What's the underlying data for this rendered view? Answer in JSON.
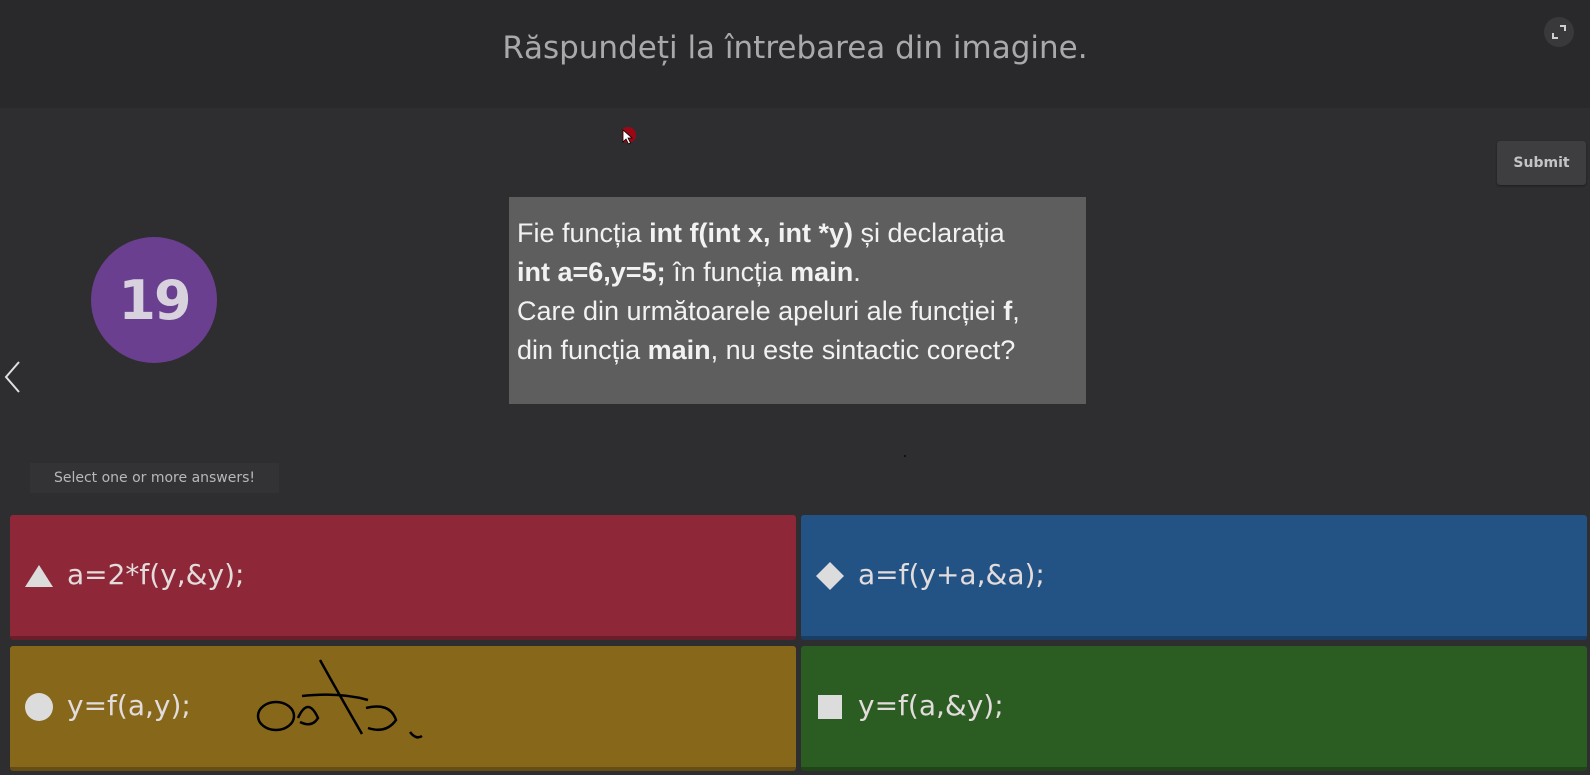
{
  "header": {
    "title": "Răspundeți la întrebarea din imagine.",
    "fullscreen_icon": "expand-icon"
  },
  "toolbar": {
    "submit_label": "Submit"
  },
  "question": {
    "number": "19",
    "image_text": {
      "line1_a": "Fie funcția ",
      "line1_b": "int f(int x, int *y)",
      "line1_c": " și declarația",
      "line2_a": "int a=6,y=5;",
      "line2_b": " în funcția ",
      "line2_c": "main",
      "line2_d": ".",
      "line3_a": "Care din următoarele apeluri ale funcției ",
      "line3_b": "f",
      "line3_c": ",",
      "line4_a": "din funcția ",
      "line4_b": "main",
      "line4_c": ", nu este sintactic corect?"
    }
  },
  "hint": "Select one or more answers!",
  "answers": [
    {
      "shape": "triangle-icon",
      "color": "#8e2838",
      "text": "a=2*f(y,&y);"
    },
    {
      "shape": "diamond-icon",
      "color": "#235385",
      "text": "a=f(y+a,&a);"
    },
    {
      "shape": "circle-icon",
      "color": "#87681a",
      "text": "y=f(a,y);",
      "annotation": "handwritten-scribble"
    },
    {
      "shape": "square-icon",
      "color": "#2b5d22",
      "text": "y=f(a,&y);"
    }
  ],
  "colors": {
    "background": "#2e2e30",
    "header": "#29292b",
    "badge": "#6a3f8f",
    "image_box": "#5e5e5e"
  }
}
